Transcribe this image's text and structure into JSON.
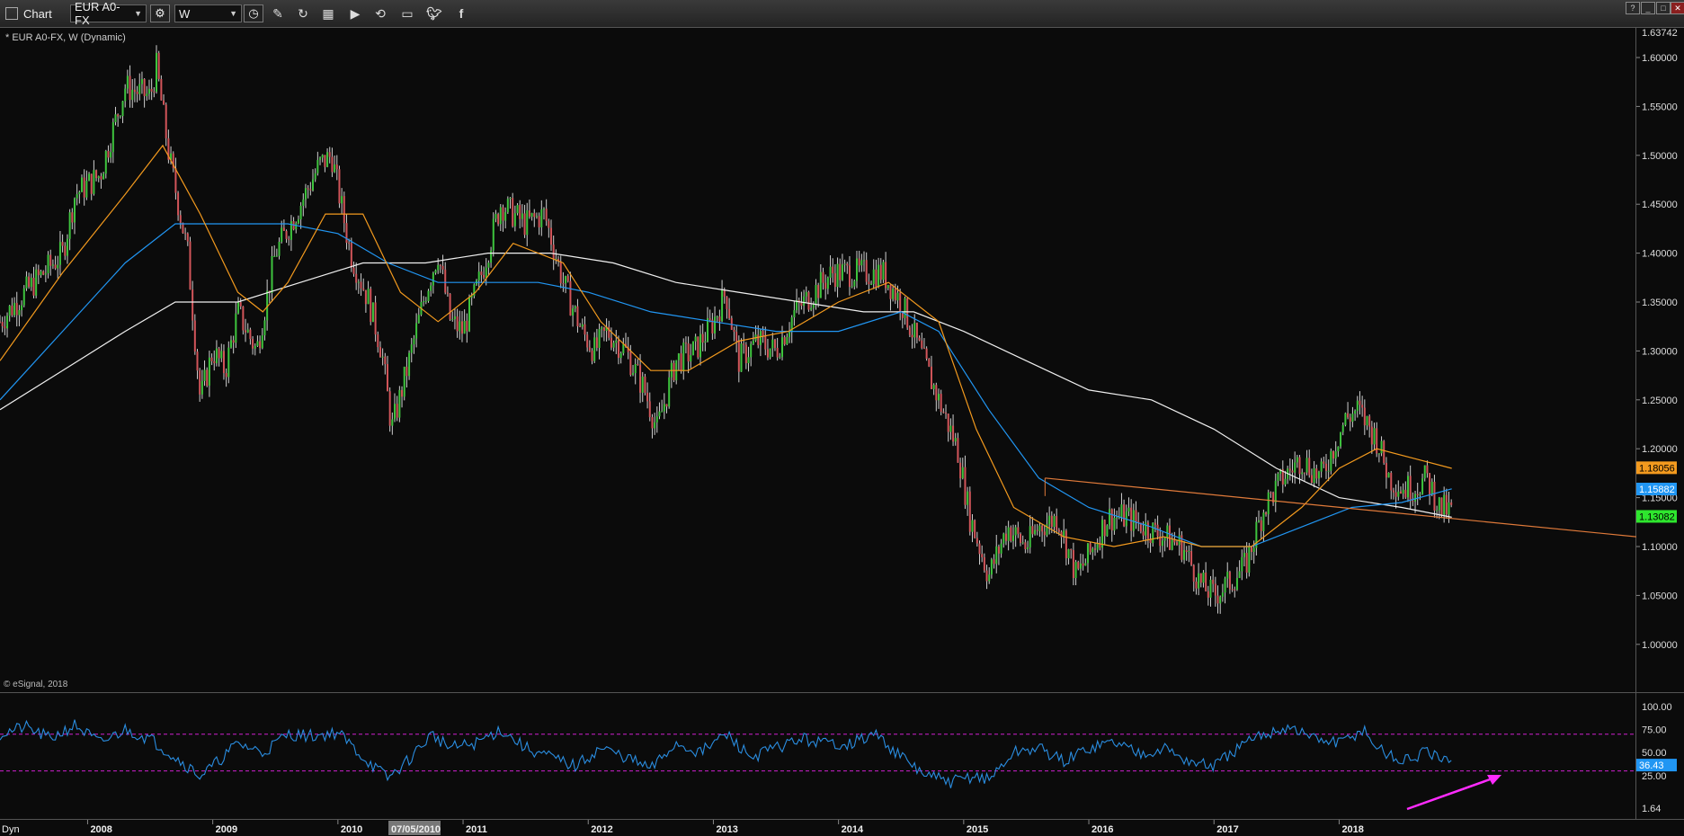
{
  "toolbar": {
    "title": "Chart",
    "symbol": "EUR A0-FX",
    "interval": "W",
    "icons": [
      "settings-icon",
      "clock-icon",
      "pencil-icon",
      "refresh-icon",
      "toolbox-icon",
      "play-icon",
      "replay-icon",
      "comment-icon",
      "twitter-icon",
      "facebook-icon"
    ]
  },
  "window": {
    "help": "?",
    "min": "_",
    "max": "□",
    "close": "✕"
  },
  "chart_data": {
    "type": "candlestick",
    "header": "* EUR A0-FX, W (Dynamic)",
    "copyright": "© eSignal, 2018",
    "interval_label": "Dyn",
    "cursor_date": "07/05/2010",
    "xlabels": [
      "2008",
      "2009",
      "2010",
      "2011",
      "2012",
      "2013",
      "2014",
      "2015",
      "2016",
      "2017",
      "2018"
    ],
    "price_axis": {
      "ticks": [
        "1.60000",
        "1.55000",
        "1.50000",
        "1.45000",
        "1.40000",
        "1.35000",
        "1.30000",
        "1.25000",
        "1.20000",
        "1.15000",
        "1.10000",
        "1.05000",
        "1.00000"
      ],
      "top_value": "1.63742",
      "ylim": [
        0.96,
        1.637
      ]
    },
    "indicator_axis": {
      "ticks": [
        "100.00",
        "75.00",
        "50.00",
        "25.00"
      ],
      "bottom_value": "1.64",
      "ylim": [
        1.64,
        108
      ]
    },
    "value_tags": [
      {
        "label": "1.18056",
        "color": "#f39a1e",
        "text_color": "#000"
      },
      {
        "label": "1.15882",
        "color": "#2196f3",
        "text_color": "#fff"
      },
      {
        "label": "1.13082",
        "color": "#2ee62e",
        "text_color": "#000"
      }
    ],
    "indicator_tag": {
      "label": "36.43",
      "color": "#2196f3",
      "text_color": "#fff"
    },
    "price_keypoints": [
      [
        2007.3,
        1.33
      ],
      [
        2007.5,
        1.36
      ],
      [
        2007.8,
        1.4
      ],
      [
        2007.9,
        1.46
      ],
      [
        2008.1,
        1.48
      ],
      [
        2008.3,
        1.57
      ],
      [
        2008.5,
        1.56
      ],
      [
        2008.55,
        1.59
      ],
      [
        2008.65,
        1.5
      ],
      [
        2008.8,
        1.4
      ],
      [
        2008.9,
        1.25
      ],
      [
        2009.0,
        1.3
      ],
      [
        2009.1,
        1.28
      ],
      [
        2009.2,
        1.34
      ],
      [
        2009.35,
        1.3
      ],
      [
        2009.5,
        1.4
      ],
      [
        2009.7,
        1.45
      ],
      [
        2009.85,
        1.49
      ],
      [
        2009.95,
        1.5
      ],
      [
        2010.1,
        1.4
      ],
      [
        2010.25,
        1.35
      ],
      [
        2010.35,
        1.3
      ],
      [
        2010.43,
        1.22
      ],
      [
        2010.55,
        1.28
      ],
      [
        2010.7,
        1.36
      ],
      [
        2010.8,
        1.4
      ],
      [
        2010.9,
        1.33
      ],
      [
        2011.0,
        1.32
      ],
      [
        2011.15,
        1.38
      ],
      [
        2011.3,
        1.45
      ],
      [
        2011.5,
        1.43
      ],
      [
        2011.65,
        1.44
      ],
      [
        2011.8,
        1.37
      ],
      [
        2011.95,
        1.32
      ],
      [
        2012.05,
        1.3
      ],
      [
        2012.15,
        1.32
      ],
      [
        2012.3,
        1.3
      ],
      [
        2012.45,
        1.26
      ],
      [
        2012.55,
        1.22
      ],
      [
        2012.7,
        1.29
      ],
      [
        2012.85,
        1.3
      ],
      [
        2013.0,
        1.33
      ],
      [
        2013.1,
        1.36
      ],
      [
        2013.2,
        1.29
      ],
      [
        2013.35,
        1.31
      ],
      [
        2013.5,
        1.3
      ],
      [
        2013.65,
        1.34
      ],
      [
        2013.8,
        1.36
      ],
      [
        2013.95,
        1.38
      ],
      [
        2014.15,
        1.38
      ],
      [
        2014.35,
        1.38
      ],
      [
        2014.5,
        1.35
      ],
      [
        2014.65,
        1.3
      ],
      [
        2014.8,
        1.25
      ],
      [
        2014.95,
        1.2
      ],
      [
        2015.05,
        1.13
      ],
      [
        2015.2,
        1.07
      ],
      [
        2015.35,
        1.12
      ],
      [
        2015.5,
        1.1
      ],
      [
        2015.6,
        1.12
      ],
      [
        2015.75,
        1.13
      ],
      [
        2015.9,
        1.07
      ],
      [
        2016.0,
        1.09
      ],
      [
        2016.15,
        1.13
      ],
      [
        2016.3,
        1.13
      ],
      [
        2016.45,
        1.12
      ],
      [
        2016.6,
        1.11
      ],
      [
        2016.75,
        1.1
      ],
      [
        2016.9,
        1.06
      ],
      [
        2017.0,
        1.05
      ],
      [
        2017.1,
        1.06
      ],
      [
        2017.25,
        1.08
      ],
      [
        2017.4,
        1.14
      ],
      [
        2017.55,
        1.17
      ],
      [
        2017.7,
        1.19
      ],
      [
        2017.85,
        1.17
      ],
      [
        2017.95,
        1.2
      ],
      [
        2018.05,
        1.23
      ],
      [
        2018.15,
        1.24
      ],
      [
        2018.3,
        1.21
      ],
      [
        2018.4,
        1.17
      ],
      [
        2018.5,
        1.16
      ],
      [
        2018.6,
        1.16
      ],
      [
        2018.7,
        1.17
      ],
      [
        2018.8,
        1.14
      ],
      [
        2018.9,
        1.135
      ]
    ],
    "ma_short": [
      [
        2007.3,
        1.29
      ],
      [
        2007.8,
        1.38
      ],
      [
        2008.3,
        1.46
      ],
      [
        2008.6,
        1.51
      ],
      [
        2008.9,
        1.44
      ],
      [
        2009.2,
        1.36
      ],
      [
        2009.4,
        1.34
      ],
      [
        2009.6,
        1.37
      ],
      [
        2009.9,
        1.44
      ],
      [
        2010.2,
        1.44
      ],
      [
        2010.5,
        1.36
      ],
      [
        2010.8,
        1.33
      ],
      [
        2011.1,
        1.36
      ],
      [
        2011.4,
        1.41
      ],
      [
        2011.8,
        1.39
      ],
      [
        2012.1,
        1.33
      ],
      [
        2012.5,
        1.28
      ],
      [
        2012.8,
        1.28
      ],
      [
        2013.2,
        1.31
      ],
      [
        2013.6,
        1.32
      ],
      [
        2014.0,
        1.35
      ],
      [
        2014.4,
        1.37
      ],
      [
        2014.8,
        1.33
      ],
      [
        2015.1,
        1.22
      ],
      [
        2015.4,
        1.14
      ],
      [
        2015.8,
        1.11
      ],
      [
        2016.2,
        1.1
      ],
      [
        2016.6,
        1.11
      ],
      [
        2016.9,
        1.1
      ],
      [
        2017.3,
        1.1
      ],
      [
        2017.7,
        1.14
      ],
      [
        2018.0,
        1.18
      ],
      [
        2018.3,
        1.2
      ],
      [
        2018.6,
        1.19
      ],
      [
        2018.9,
        1.18
      ]
    ],
    "ma_mid": [
      [
        2007.3,
        1.25
      ],
      [
        2007.8,
        1.32
      ],
      [
        2008.3,
        1.39
      ],
      [
        2008.7,
        1.43
      ],
      [
        2009.1,
        1.43
      ],
      [
        2009.6,
        1.43
      ],
      [
        2010.0,
        1.42
      ],
      [
        2010.4,
        1.39
      ],
      [
        2010.8,
        1.37
      ],
      [
        2011.2,
        1.37
      ],
      [
        2011.6,
        1.37
      ],
      [
        2012.0,
        1.36
      ],
      [
        2012.5,
        1.34
      ],
      [
        2013.0,
        1.33
      ],
      [
        2013.5,
        1.32
      ],
      [
        2014.0,
        1.32
      ],
      [
        2014.5,
        1.34
      ],
      [
        2014.8,
        1.32
      ],
      [
        2015.2,
        1.24
      ],
      [
        2015.6,
        1.17
      ],
      [
        2016.0,
        1.14
      ],
      [
        2016.5,
        1.12
      ],
      [
        2016.9,
        1.1
      ],
      [
        2017.3,
        1.1
      ],
      [
        2017.7,
        1.12
      ],
      [
        2018.1,
        1.14
      ],
      [
        2018.5,
        1.145
      ],
      [
        2018.9,
        1.159
      ]
    ],
    "ma_long": [
      [
        2007.3,
        1.24
      ],
      [
        2007.8,
        1.28
      ],
      [
        2008.3,
        1.32
      ],
      [
        2008.7,
        1.35
      ],
      [
        2009.2,
        1.35
      ],
      [
        2009.7,
        1.37
      ],
      [
        2010.2,
        1.39
      ],
      [
        2010.7,
        1.39
      ],
      [
        2011.2,
        1.4
      ],
      [
        2011.7,
        1.4
      ],
      [
        2012.2,
        1.39
      ],
      [
        2012.7,
        1.37
      ],
      [
        2013.2,
        1.36
      ],
      [
        2013.7,
        1.35
      ],
      [
        2014.2,
        1.34
      ],
      [
        2014.6,
        1.34
      ],
      [
        2015.0,
        1.32
      ],
      [
        2015.5,
        1.29
      ],
      [
        2016.0,
        1.26
      ],
      [
        2016.5,
        1.25
      ],
      [
        2017.0,
        1.22
      ],
      [
        2017.5,
        1.18
      ],
      [
        2018.0,
        1.15
      ],
      [
        2018.5,
        1.14
      ],
      [
        2018.9,
        1.13
      ]
    ],
    "trendline": [
      [
        2015.65,
        1.17
      ],
      [
        2019.4,
        1.11
      ]
    ],
    "rsi_keypoints": [
      [
        2007.3,
        70
      ],
      [
        2007.5,
        78
      ],
      [
        2007.7,
        65
      ],
      [
        2007.9,
        80
      ],
      [
        2008.1,
        60
      ],
      [
        2008.3,
        75
      ],
      [
        2008.5,
        65
      ],
      [
        2008.7,
        45
      ],
      [
        2008.9,
        25
      ],
      [
        2009.0,
        35
      ],
      [
        2009.2,
        60
      ],
      [
        2009.4,
        50
      ],
      [
        2009.6,
        70
      ],
      [
        2009.8,
        68
      ],
      [
        2010.0,
        72
      ],
      [
        2010.2,
        45
      ],
      [
        2010.4,
        22
      ],
      [
        2010.55,
        40
      ],
      [
        2010.75,
        70
      ],
      [
        2010.9,
        55
      ],
      [
        2011.1,
        60
      ],
      [
        2011.3,
        75
      ],
      [
        2011.5,
        55
      ],
      [
        2011.7,
        45
      ],
      [
        2011.9,
        35
      ],
      [
        2012.1,
        55
      ],
      [
        2012.3,
        45
      ],
      [
        2012.5,
        32
      ],
      [
        2012.7,
        60
      ],
      [
        2012.9,
        50
      ],
      [
        2013.1,
        70
      ],
      [
        2013.3,
        45
      ],
      [
        2013.5,
        55
      ],
      [
        2013.7,
        65
      ],
      [
        2013.9,
        60
      ],
      [
        2014.1,
        60
      ],
      [
        2014.3,
        70
      ],
      [
        2014.5,
        45
      ],
      [
        2014.7,
        25
      ],
      [
        2014.9,
        18
      ],
      [
        2015.1,
        25
      ],
      [
        2015.2,
        20
      ],
      [
        2015.4,
        50
      ],
      [
        2015.6,
        55
      ],
      [
        2015.8,
        40
      ],
      [
        2016.0,
        55
      ],
      [
        2016.2,
        62
      ],
      [
        2016.4,
        50
      ],
      [
        2016.6,
        55
      ],
      [
        2016.8,
        40
      ],
      [
        2017.0,
        35
      ],
      [
        2017.2,
        55
      ],
      [
        2017.4,
        70
      ],
      [
        2017.6,
        78
      ],
      [
        2017.8,
        65
      ],
      [
        2018.0,
        60
      ],
      [
        2018.2,
        75
      ],
      [
        2018.3,
        55
      ],
      [
        2018.5,
        40
      ],
      [
        2018.7,
        50
      ],
      [
        2018.9,
        36
      ]
    ],
    "rsi_levels": [
      70,
      30
    ]
  }
}
